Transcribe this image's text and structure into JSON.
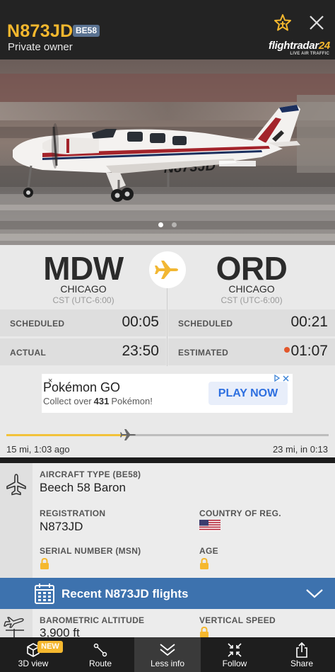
{
  "header": {
    "callsign": "N873JD",
    "aircraft_code": "BE58",
    "owner": "Private owner",
    "brand_name": "flightradar",
    "brand_number": "24",
    "brand_tagline": "LIVE AIR TRAFFIC"
  },
  "photo": {
    "registration_on_fuselage": "N873JD",
    "dots_count": 2,
    "active_dot": 1
  },
  "route": {
    "origin": {
      "code": "MDW",
      "city": "CHICAGO",
      "timezone": "CST (UTC-6:00)"
    },
    "destination": {
      "code": "ORD",
      "city": "CHICAGO",
      "timezone": "CST (UTC-6:00)"
    },
    "times": {
      "dep_scheduled_label": "SCHEDULED",
      "dep_scheduled": "00:05",
      "arr_scheduled_label": "SCHEDULED",
      "arr_scheduled": "00:21",
      "dep_actual_label": "ACTUAL",
      "dep_actual": "23:50",
      "arr_estimated_label": "ESTIMATED",
      "arr_estimated": "01:07"
    }
  },
  "ad": {
    "title": "Pokémon GO",
    "subtitle_prefix": "Collect over",
    "subtitle_count": "431",
    "subtitle_suffix": "Pokémon!",
    "cta": "PLAY NOW",
    "close": "×",
    "choices_icon": "ad-choices-icon"
  },
  "progress": {
    "fraction": 0.37,
    "left_text": "15 mi, 1:03 ago",
    "right_text": "23 mi, in 0:13"
  },
  "aircraft": {
    "type_label": "AIRCRAFT TYPE (BE58)",
    "type_value": "Beech 58 Baron",
    "registration_label": "REGISTRATION",
    "registration_value": "N873JD",
    "country_label": "COUNTRY OF REG.",
    "country_flag": "us-flag-icon",
    "serial_label": "SERIAL NUMBER (MSN)",
    "age_label": "AGE"
  },
  "recent": {
    "label": "Recent N873JD flights"
  },
  "altitude": {
    "baro_label": "BAROMETRIC ALTITUDE",
    "baro_value": "3,900 ft",
    "vs_label": "VERTICAL SPEED"
  },
  "nav": {
    "new_badge": "NEW",
    "items": [
      {
        "label": "3D view",
        "icon": "cube-icon"
      },
      {
        "label": "Route",
        "icon": "route-icon"
      },
      {
        "label": "Less info",
        "icon": "chevrons-down-icon"
      },
      {
        "label": "Follow",
        "icon": "follow-icon"
      },
      {
        "label": "Share",
        "icon": "share-icon"
      }
    ]
  },
  "colors": {
    "accent": "#f5b82e",
    "blue_bar": "#3d72ae",
    "badge": "#5a7291"
  }
}
